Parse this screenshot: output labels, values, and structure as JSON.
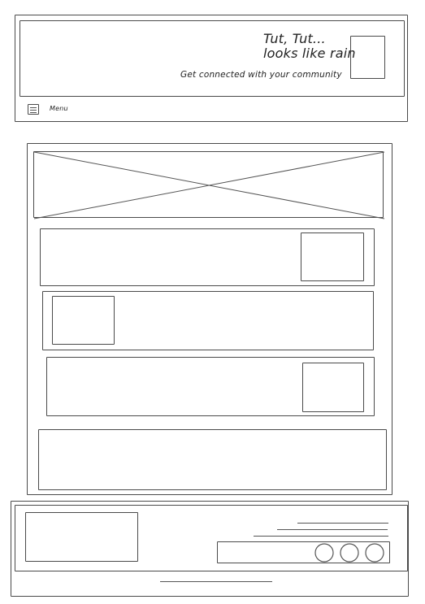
{
  "header": {
    "title_line1": "Tut, Tut...",
    "title_line2": "looks like rain",
    "tagline": "Get connected with your community"
  },
  "nav": {
    "menu_label": "Menu",
    "menu_icon": "menu-icon"
  },
  "footer": {
    "social_icons": [
      "social-icon",
      "social-icon",
      "social-icon"
    ]
  }
}
